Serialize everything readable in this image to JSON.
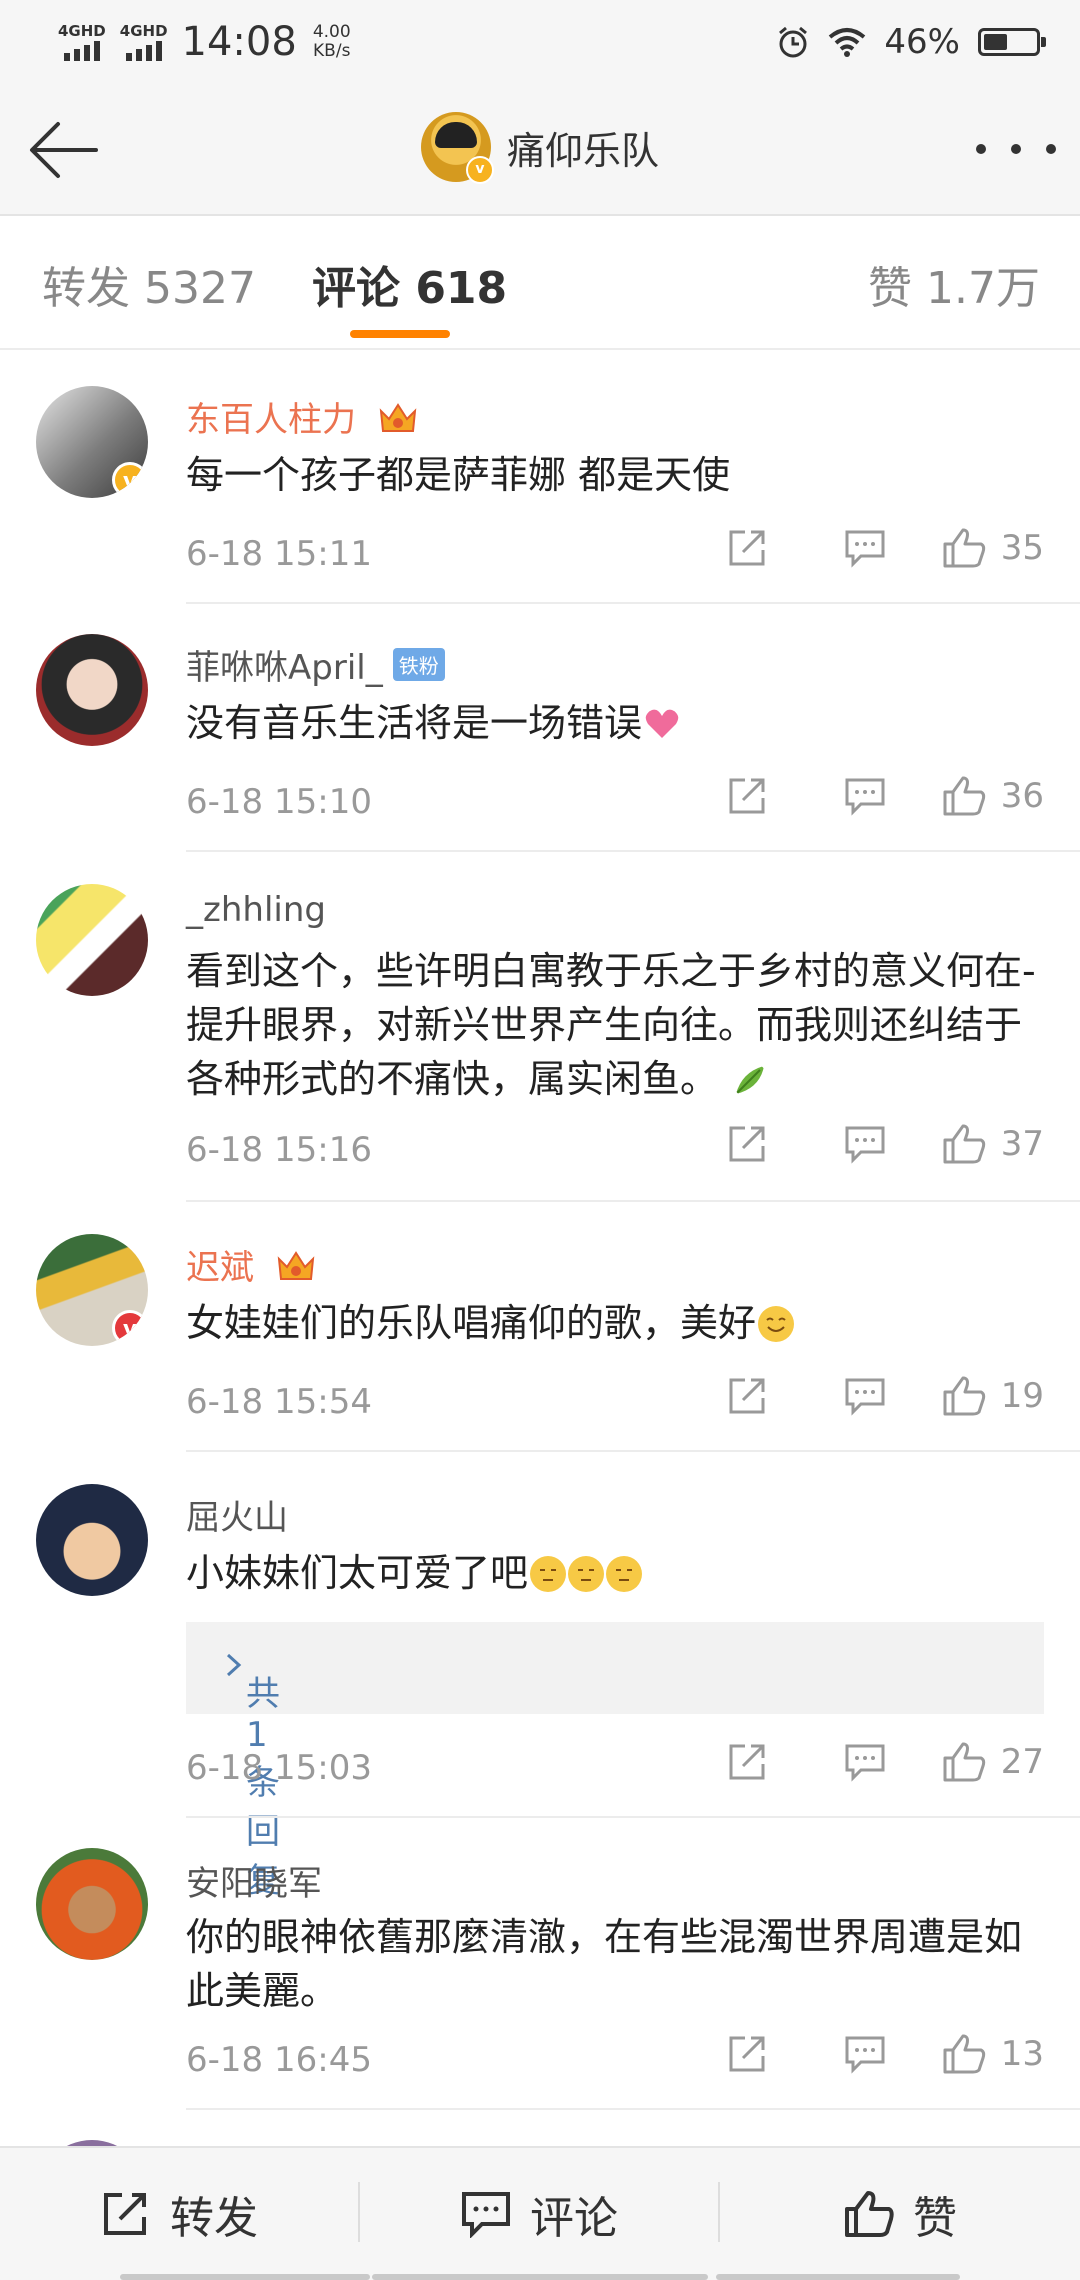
{
  "status_bar": {
    "network1": "4GHD",
    "network2": "4GHD",
    "time": "14:08",
    "speed_value": "4.00",
    "speed_unit": "KB/s",
    "battery": "46%",
    "battery_level": 0.46
  },
  "header": {
    "title": "痛仰乐队"
  },
  "tabs": [
    {
      "label": "转发 5327"
    },
    {
      "label": "评论 618"
    },
    {
      "label": "赞 1.7万"
    }
  ],
  "comments": [
    {
      "user": "东百人柱力",
      "text": "每一个孩子都是萨菲娜 都是天使",
      "time": "6-18 15:11",
      "likes": "35"
    },
    {
      "user": "菲咻咻April_",
      "badge": "铁粉",
      "text": "没有音乐生活将是一场错误",
      "time": "6-18 15:10",
      "likes": "36"
    },
    {
      "user": "_zhhling",
      "text": "看到这个，些许明白寓教于乐之于乡村的意义何在-提升眼界，对新兴世界产生向往。而我则还纠结于各种形式的不痛快，属实闲鱼。",
      "time": "6-18 15:16",
      "likes": "37"
    },
    {
      "user": "迟斌",
      "text": "女娃娃们的乐队唱痛仰的歌，美好",
      "time": "6-18 15:54",
      "likes": "19"
    },
    {
      "user": "屈火山",
      "text": "小妹妹们太可爱了吧",
      "reply_summary": "共1条回复",
      "time": "6-18 15:03",
      "likes": "27"
    },
    {
      "user": "安阳晓军",
      "text": "你的眼神依舊那麼清澈，在有些混濁世界周遭是如此美麗。",
      "time": "6-18 16:45",
      "likes": "13"
    }
  ],
  "bottom_bar": {
    "repost": "转发",
    "comment": "评论",
    "like": "赞"
  },
  "colors": {
    "accent": "#ff8200",
    "vip_name": "#eb7350",
    "link": "#507daf",
    "fan_badge": "#6fa9e7"
  }
}
